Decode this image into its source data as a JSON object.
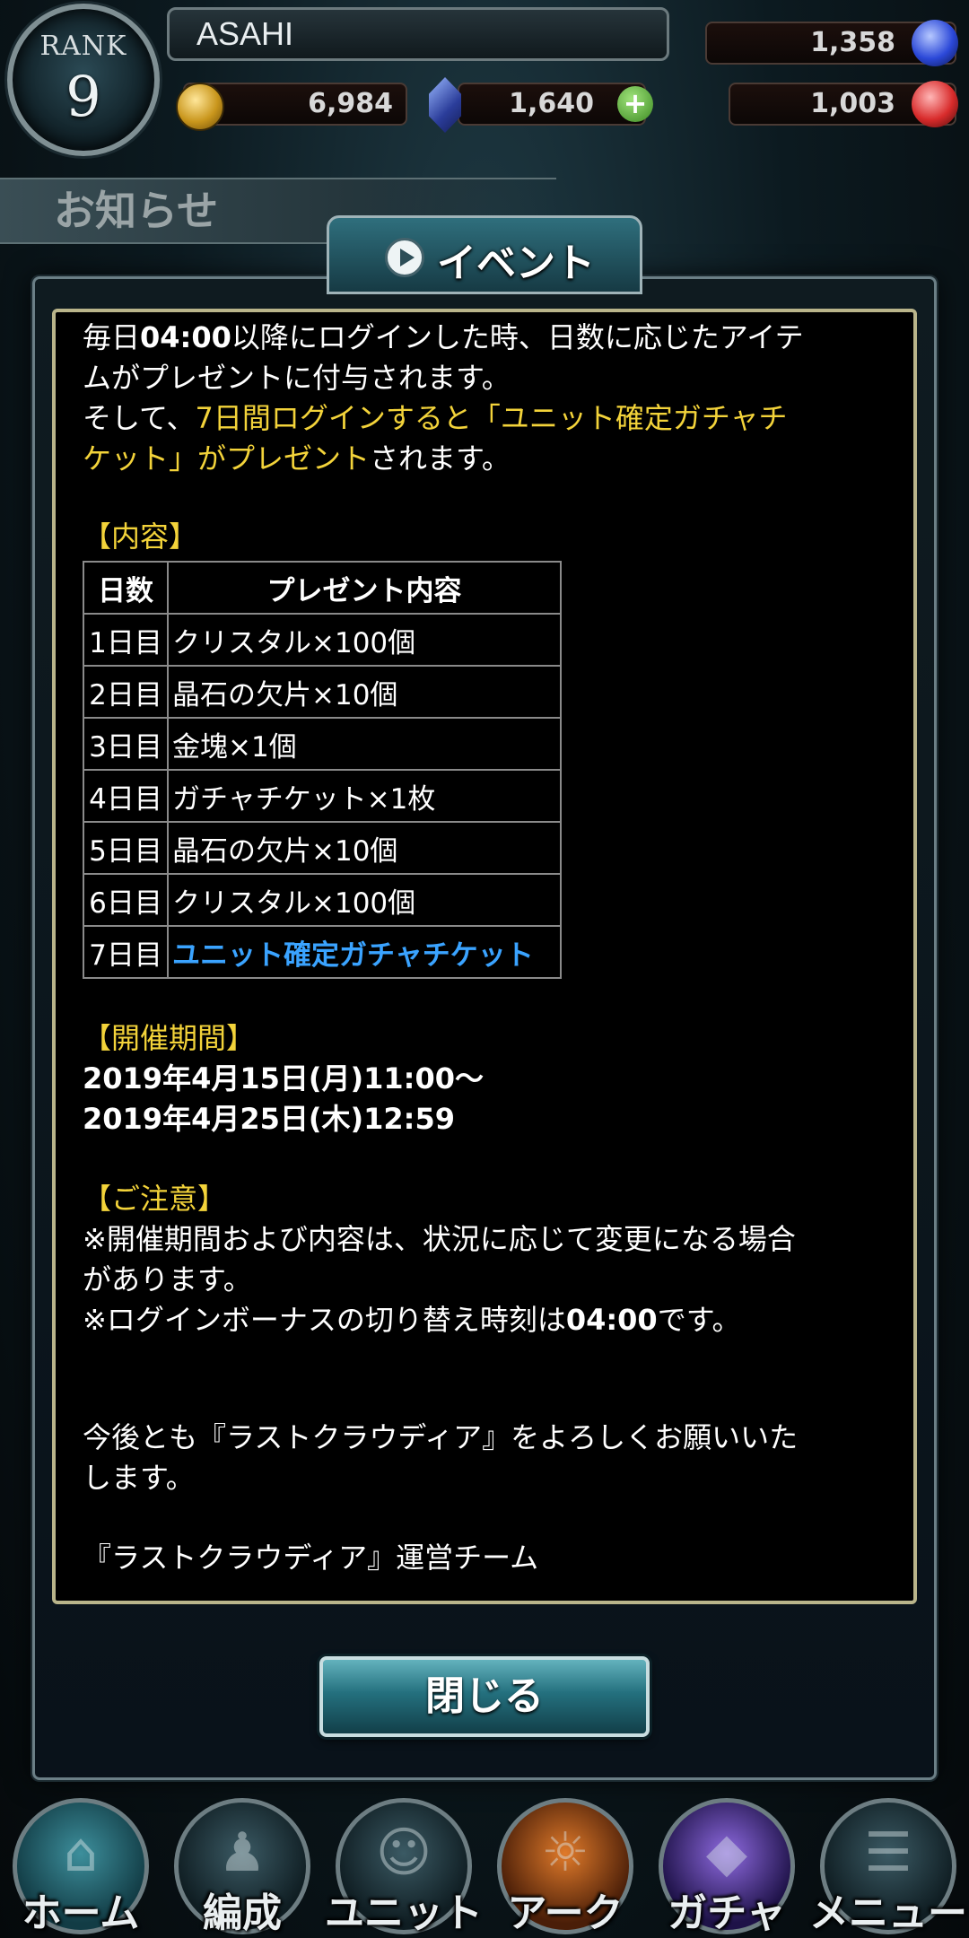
{
  "header": {
    "rank_label": "RANK",
    "rank_value": "9",
    "player_name": "ASAHI",
    "gold": "6,984",
    "crystal": "1,640",
    "blue_currency": "1,358",
    "red_currency": "1,003"
  },
  "page": {
    "title": "お知らせ"
  },
  "dialog": {
    "tab_title": "イベント",
    "intro_line1_a": "毎日",
    "intro_line1_b": "04:00",
    "intro_line1_c": "以降にログインした時、日数に応じたアイテ",
    "intro_line2": "ムがプレゼントに付与されます。",
    "intro_line3_a": "そして、",
    "intro_line3_b": "7日間ログインすると「ユニット確定ガチャチ",
    "intro_line4_a": "ケット」がプレゼント",
    "intro_line4_b": "されます。",
    "contents_heading": "【内容】",
    "table_header_day": "日数",
    "table_header_reward": "プレゼント内容",
    "rewards": [
      {
        "day": "1日目",
        "item": "クリスタル×100個"
      },
      {
        "day": "2日目",
        "item": "晶石の欠片×10個"
      },
      {
        "day": "3日目",
        "item": "金塊×1個"
      },
      {
        "day": "4日目",
        "item": "ガチャチケット×1枚"
      },
      {
        "day": "5日目",
        "item": "晶石の欠片×10個"
      },
      {
        "day": "6日目",
        "item": "クリスタル×100個"
      },
      {
        "day": "7日目",
        "item": "ユニット確定ガチャチケット"
      }
    ],
    "period_heading": "【開催期間】",
    "period_start": "2019年4月15日(月)11:00～",
    "period_end": "2019年4月25日(木)12:59",
    "notes_heading": "【ご注意】",
    "note1_line1": "※開催期間および内容は、状況に応じて変更になる場合",
    "note1_line2": "があります。",
    "note2_a": "※ログインボーナスの切り替え時刻は",
    "note2_b": "04:00",
    "note2_c": "です。",
    "closing_line1": "今後とも『ラストクラウディア』をよろしくお願いいた",
    "closing_line2": "します。",
    "signature": "『ラストクラウディア』運営チーム",
    "close_button": "閉じる"
  },
  "nav": {
    "home": "ホーム",
    "party": "編成",
    "unit": "ユニット",
    "arc": "アーク",
    "gacha": "ガチャ",
    "menu": "メニュー"
  },
  "colors": {
    "highlight_yellow": "#f3d33a",
    "highlight_blue": "#3aa3ff",
    "frame_gold": "#b9b48a"
  }
}
